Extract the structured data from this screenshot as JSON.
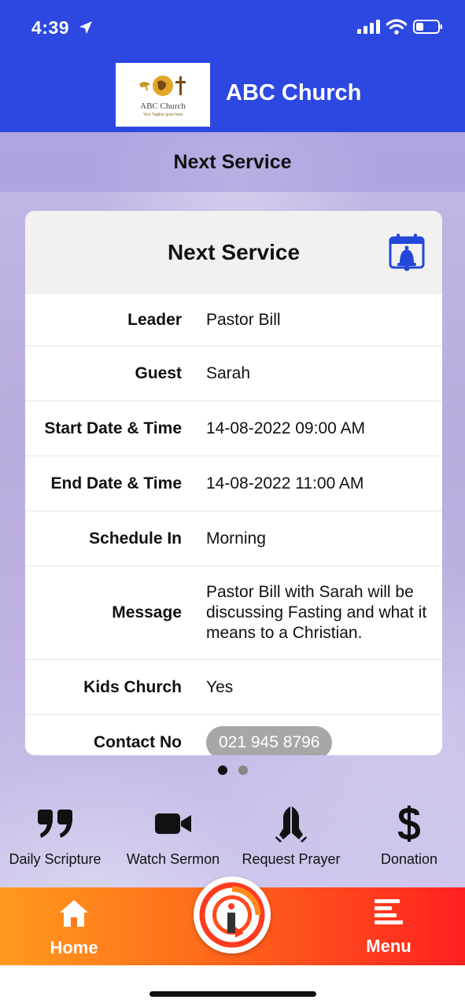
{
  "status": {
    "time": "4:39"
  },
  "header": {
    "title": "ABC Church",
    "logo_name": "ABC Church",
    "logo_tagline": "Your Tagline goes here"
  },
  "subheader": {
    "title": "Next Service"
  },
  "card": {
    "title": "Next Service",
    "rows": [
      {
        "label": "Leader",
        "value": "Pastor Bill"
      },
      {
        "label": "Guest",
        "value": "Sarah"
      },
      {
        "label": "Start Date & Time",
        "value": "14-08-2022 09:00 AM"
      },
      {
        "label": "End Date & Time",
        "value": "14-08-2022 11:00 AM"
      },
      {
        "label": "Schedule In",
        "value": "Morning"
      },
      {
        "label": "Message",
        "value": "Pastor Bill with Sarah will be discussing Fasting and what it means to a Christian."
      },
      {
        "label": "Kids Church",
        "value": "Yes"
      },
      {
        "label": "Contact No",
        "value": "021 945 8796"
      }
    ]
  },
  "pager": {
    "pages": 2,
    "active": 1
  },
  "quick_actions": [
    {
      "label": "Daily Scripture",
      "icon": "quote-icon"
    },
    {
      "label": "Watch Sermon",
      "icon": "video-camera-icon"
    },
    {
      "label": "Request Prayer",
      "icon": "praying-hands-icon"
    },
    {
      "label": "Donation",
      "icon": "dollar-icon"
    }
  ],
  "tabbar": {
    "home_label": "Home",
    "menu_label": "Menu",
    "center_icon": "app-logo-icon"
  },
  "colors": {
    "header_blue": "#2d48e0",
    "accent_blue": "#2347d8",
    "tab_gradient_start": "#ff9a1e",
    "tab_gradient_end": "#ff2020"
  }
}
